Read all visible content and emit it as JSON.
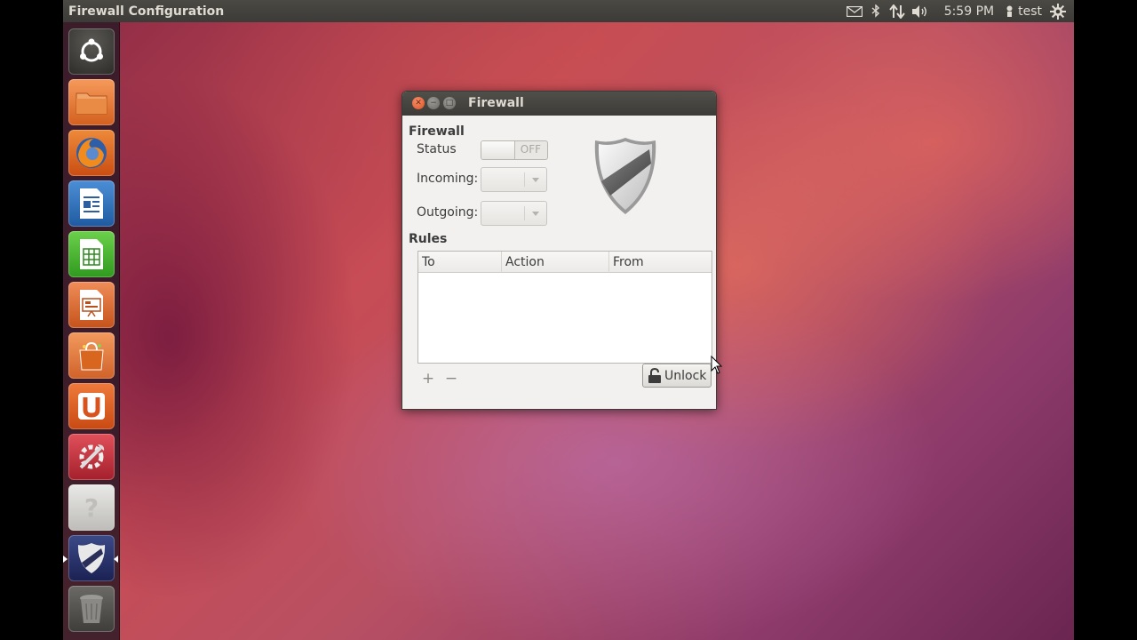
{
  "top_panel": {
    "app_title": "Firewall Configuration",
    "clock": "5:59 PM",
    "user": "test",
    "icons": [
      "mail-icon",
      "bluetooth-icon",
      "network-icon",
      "volume-icon",
      "user-icon",
      "session-gear-icon"
    ]
  },
  "launcher": {
    "items": [
      {
        "name": "dash-home",
        "icon": "ubuntu-logo-icon"
      },
      {
        "name": "files",
        "icon": "folder-icon"
      },
      {
        "name": "firefox",
        "icon": "firefox-icon"
      },
      {
        "name": "writer",
        "icon": "libreoffice-writer-icon"
      },
      {
        "name": "calc",
        "icon": "libreoffice-calc-icon"
      },
      {
        "name": "impress",
        "icon": "libreoffice-impress-icon"
      },
      {
        "name": "software-center",
        "icon": "shopping-bag-icon"
      },
      {
        "name": "ubuntu-one",
        "icon": "ubuntu-one-icon"
      },
      {
        "name": "system-settings",
        "icon": "settings-tools-icon"
      },
      {
        "name": "help",
        "icon": "question-icon"
      },
      {
        "name": "firewall",
        "icon": "shield-icon",
        "active": true
      },
      {
        "name": "trash",
        "icon": "trash-icon"
      }
    ]
  },
  "window": {
    "title": "Firewall",
    "firewall_section": "Firewall",
    "status_label": "Status",
    "status_value": "OFF",
    "incoming_label": "Incoming:",
    "outgoing_label": "Outgoing:",
    "rules_section": "Rules",
    "columns": [
      "To",
      "Action",
      "From"
    ],
    "add_symbol": "+",
    "remove_symbol": "−",
    "unlock_label": "Unlock"
  },
  "colors": {
    "panel": "#3c3b37",
    "window_bg": "#f2f1f0",
    "close_button": "#dd4f22"
  }
}
